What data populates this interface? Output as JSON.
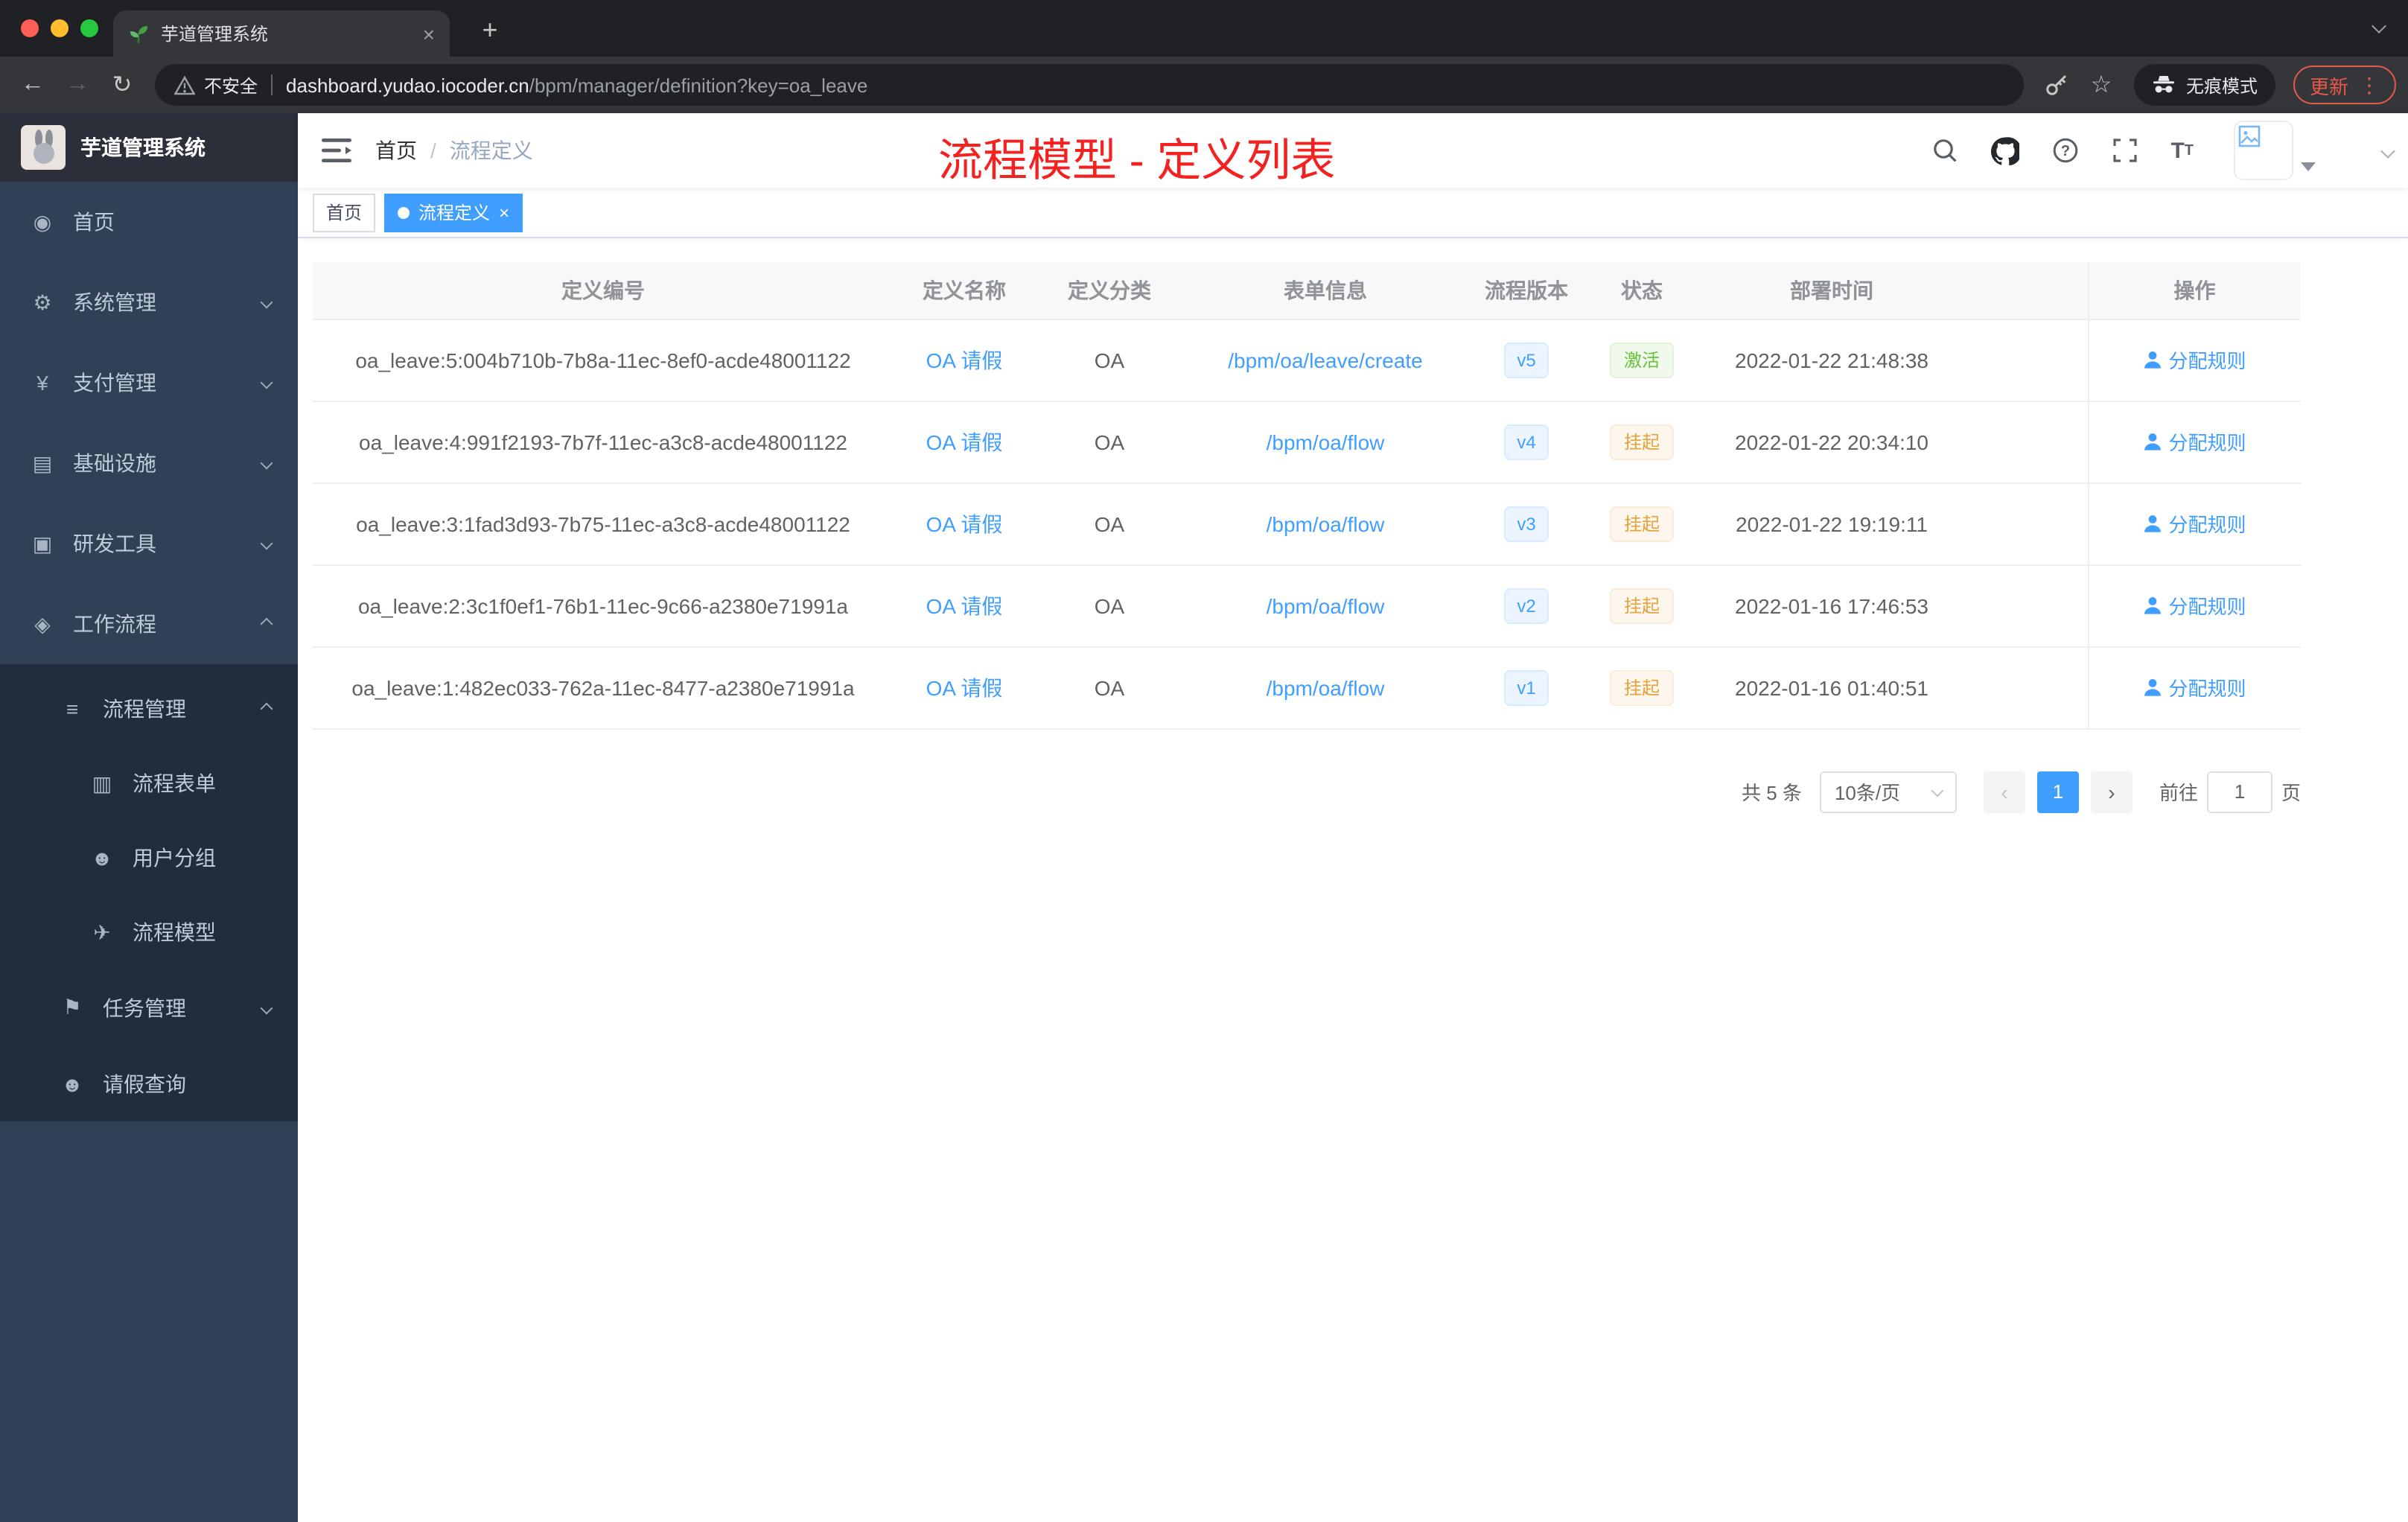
{
  "browser": {
    "tab_title": "芋道管理系统",
    "security_label": "不安全",
    "url_domain": "dashboard.yudao.iocoder.cn",
    "url_path": "/bpm/manager/definition?key=oa_leave",
    "incognito_label": "无痕模式",
    "update_label": "更新"
  },
  "icons": {
    "home": "◉",
    "system": "⚙",
    "payment": "¥",
    "infra": "▤",
    "devtools": "▣",
    "workflow": "◈",
    "process_manage": "≡",
    "form": "▥",
    "user_group": "☻",
    "model": "✈",
    "task": "⚑",
    "leave": "☻",
    "back": "←",
    "forward": "→",
    "reload": "↻",
    "star": "☆",
    "close": "×",
    "new_tab": "+",
    "menu_dots": "⋮",
    "prev": "‹",
    "next": "›"
  },
  "sidebar": {
    "logo_title": "芋道管理系统",
    "items": [
      {
        "label": "首页"
      },
      {
        "label": "系统管理"
      },
      {
        "label": "支付管理"
      },
      {
        "label": "基础设施"
      },
      {
        "label": "研发工具"
      },
      {
        "label": "工作流程"
      },
      {
        "label": "流程管理"
      },
      {
        "label": "流程表单"
      },
      {
        "label": "用户分组"
      },
      {
        "label": "流程模型"
      },
      {
        "label": "任务管理"
      },
      {
        "label": "请假查询"
      }
    ]
  },
  "navbar": {
    "breadcrumb_home": "首页",
    "breadcrumb_sep": "/",
    "breadcrumb_current": "流程定义",
    "annotation": "流程模型 - 定义列表"
  },
  "tags": {
    "home": "首页",
    "current": "流程定义"
  },
  "table": {
    "headers": [
      "定义编号",
      "定义名称",
      "定义分类",
      "表单信息",
      "流程版本",
      "状态",
      "部署时间",
      "操作"
    ],
    "rows": [
      {
        "id": "oa_leave:5:004b710b-7b8a-11ec-8ef0-acde48001122",
        "name": "OA 请假",
        "category": "OA",
        "form": "/bpm/oa/leave/create",
        "version": "v5",
        "status": "激活",
        "deploy_time": "2022-01-22 21:48:38",
        "action": "分配规则"
      },
      {
        "id": "oa_leave:4:991f2193-7b7f-11ec-a3c8-acde48001122",
        "name": "OA 请假",
        "category": "OA",
        "form": "/bpm/oa/flow",
        "version": "v4",
        "status": "挂起",
        "deploy_time": "2022-01-22 20:34:10",
        "action": "分配规则"
      },
      {
        "id": "oa_leave:3:1fad3d93-7b75-11ec-a3c8-acde48001122",
        "name": "OA 请假",
        "category": "OA",
        "form": "/bpm/oa/flow",
        "version": "v3",
        "status": "挂起",
        "deploy_time": "2022-01-22 19:19:11",
        "action": "分配规则"
      },
      {
        "id": "oa_leave:2:3c1f0ef1-76b1-11ec-9c66-a2380e71991a",
        "name": "OA 请假",
        "category": "OA",
        "form": "/bpm/oa/flow",
        "version": "v2",
        "status": "挂起",
        "deploy_time": "2022-01-16 17:46:53",
        "action": "分配规则"
      },
      {
        "id": "oa_leave:1:482ec033-762a-11ec-8477-a2380e71991a",
        "name": "OA 请假",
        "category": "OA",
        "form": "/bpm/oa/flow",
        "version": "v1",
        "status": "挂起",
        "deploy_time": "2022-01-16 01:40:51",
        "action": "分配规则"
      }
    ]
  },
  "pagination": {
    "total": "共 5 条",
    "page_size": "10条/页",
    "page": "1",
    "goto_label": "前往",
    "goto_value": "1",
    "unit_label": "页"
  },
  "colors": {
    "accent": "#409eff",
    "success": "#67c23a",
    "warning": "#e6a23c",
    "annotation_red": "#f42121",
    "sidebar_bg": "#304156",
    "submenu_bg": "#1f2d3d",
    "browser_dark": "#202124"
  }
}
